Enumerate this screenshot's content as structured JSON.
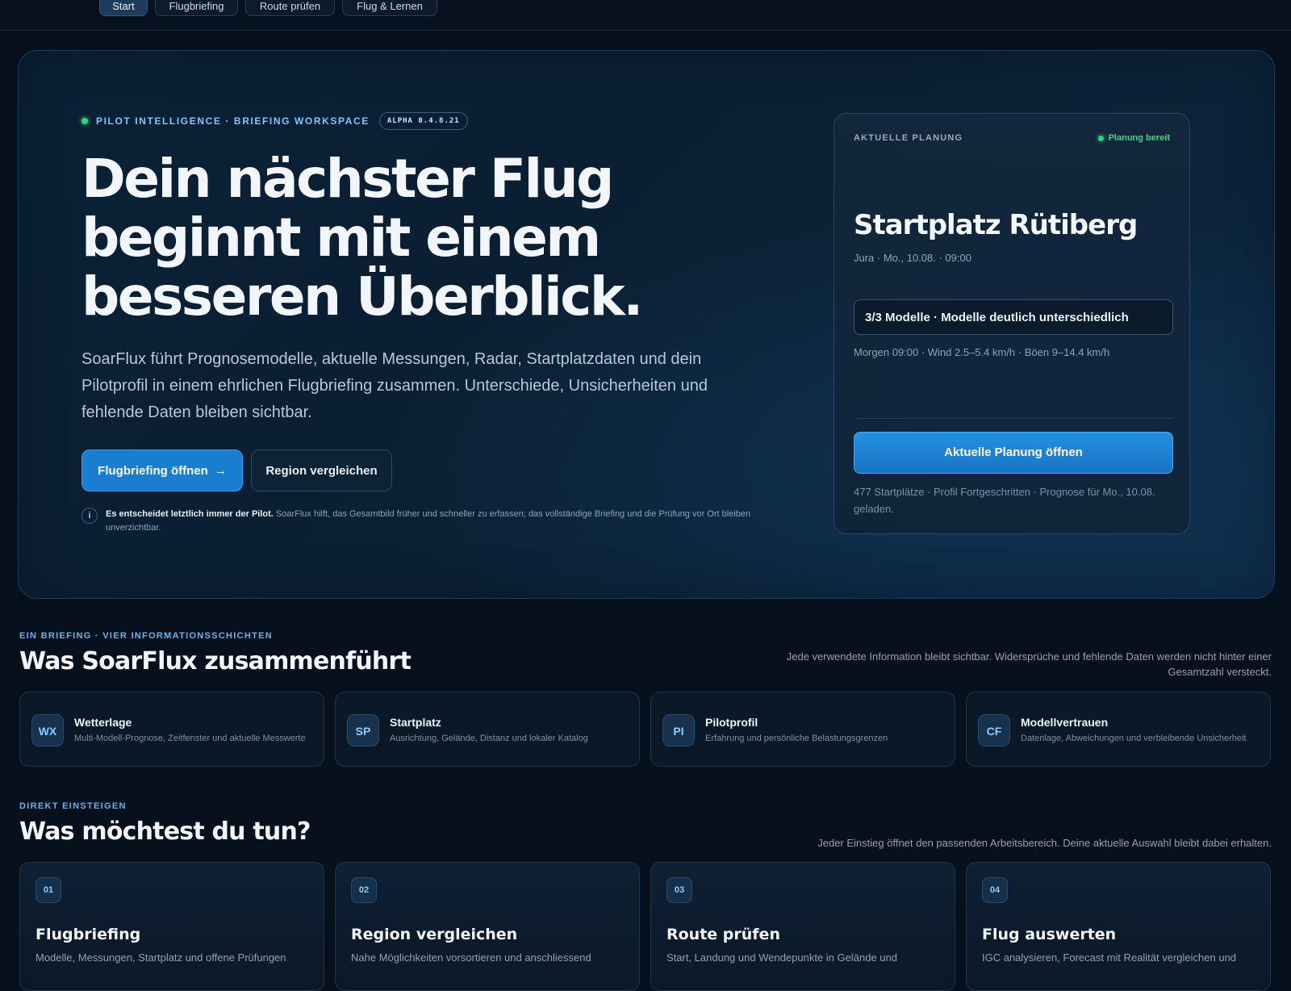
{
  "nav": {
    "tabs": [
      {
        "label": "Start"
      },
      {
        "label": "Flugbriefing"
      },
      {
        "label": "Route prüfen"
      },
      {
        "label": "Flug & Lernen"
      }
    ]
  },
  "hero": {
    "eyebrow": "PILOT INTELLIGENCE · BRIEFING WORKSPACE",
    "version": "ALPHA 0.4.8.21",
    "title_line1": "Dein nächster Flug",
    "title_line2": "beginnt mit einem",
    "title_line3": "besseren Überblick.",
    "description": "SoarFlux führt Prognosemodelle, aktuelle Messungen, Radar, Startplatzdaten und dein Pilotprofil in einem ehrlichen Flugbriefing zusammen. Unterschiede, Unsicherheiten und fehlende Daten bleiben sichtbar.",
    "primary_button": "Flugbriefing öffnen",
    "primary_arrow": "→",
    "secondary_button": "Region vergleichen",
    "note_strong": "Es entscheidet letztlich immer der Pilot.",
    "note_text": " SoarFlux hilft, das Gesamtbild früher und schneller zu erfassen; das vollständige Briefing und die Prüfung vor Ort bleiben unverzichtbar.",
    "info_icon": "info-icon"
  },
  "planning": {
    "label": "AKTUELLE PLANUNG",
    "status": "Planung bereit",
    "status_color": "#3fd58a",
    "title": "Startplatz Rütiberg",
    "meta": "Jura · Mo., 10.08. · 09:00",
    "models": "3/3 Modelle · Modelle deutlich unterschiedlich",
    "weather": "Morgen 09:00 · Wind 2.5–5.4 km/h · Böen 9–14.4 km/h",
    "button": "Aktuelle Planung öffnen",
    "footer": "477 Startplätze · Profil Fortgeschritten · Prognose für Mo., 10.08. geladen."
  },
  "layers_section": {
    "eyebrow": "EIN BRIEFING · VIER INFORMATIONSSCHICHTEN",
    "title": "Was SoarFlux zusammenführt",
    "aside": "Jede verwendete Information bleibt sichtbar. Widersprüche und fehlende Daten werden nicht hinter einer Gesamtzahl versteckt.",
    "items": [
      {
        "badge": "WX",
        "title": "Wetterlage",
        "subtitle": "Multi-Modell-Prognose, Zeitfenster und aktuelle Messwerte"
      },
      {
        "badge": "SP",
        "title": "Startplatz",
        "subtitle": "Ausrichtung, Gelände, Distanz und lokaler Katalog"
      },
      {
        "badge": "PI",
        "title": "Pilotprofil",
        "subtitle": "Erfahrung und persönliche Belastungsgrenzen"
      },
      {
        "badge": "CF",
        "title": "Modellvertrauen",
        "subtitle": "Datenlage, Abweichungen und verbleibende Unsicherheit"
      }
    ]
  },
  "actions_section": {
    "eyebrow": "DIREKT EINSTEIGEN",
    "title": "Was möchtest du tun?",
    "aside": "Jeder Einstieg öffnet den passenden Arbeitsbereich. Deine aktuelle Auswahl bleibt dabei erhalten.",
    "items": [
      {
        "num": "01",
        "title": "Flugbriefing",
        "subtitle": "Modelle, Messungen, Startplatz und offene Prüfungen"
      },
      {
        "num": "02",
        "title": "Region vergleichen",
        "subtitle": "Nahe Möglichkeiten vorsortieren und anschliessend"
      },
      {
        "num": "03",
        "title": "Route prüfen",
        "subtitle": "Start, Landung und Wendepunkte in Gelände und"
      },
      {
        "num": "04",
        "title": "Flug auswerten",
        "subtitle": "IGC analysieren, Forecast mit Realität vergleichen und"
      }
    ]
  },
  "colors": {
    "accent": "#1a7ed0",
    "background": "#07101d",
    "eyebrow_blue": "#62b3f0"
  }
}
